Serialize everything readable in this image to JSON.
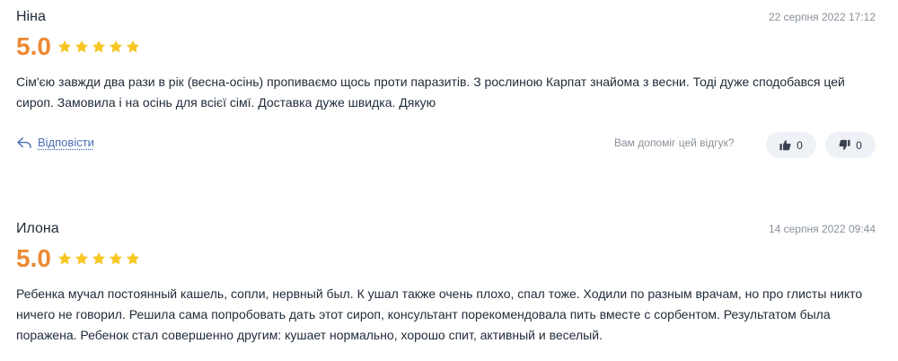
{
  "reviews": [
    {
      "author": "Ніна",
      "date": "22 серпня 2022 17:12",
      "score": "5.0",
      "stars": 5,
      "text": "Сім'єю завжди два рази в рік (весна-осінь) пропиваємо щось проти паразитів. З рослиною Карпат знайома з весни. Тоді дуже сподобався цей сироп. Замовила і на осінь для всієї сімї. Доставка дуже швидка. Дякую",
      "reply_label": "Відповісти",
      "helpful_prompt": "Вам допоміг цей відгук?",
      "likes": "0",
      "dislikes": "0"
    },
    {
      "author": "Илона",
      "date": "14 серпня 2022 09:44",
      "score": "5.0",
      "stars": 5,
      "text": "Ребенка мучал постоянный кашель, сопли, нервный был. К ушал также очень плохо, спал тоже. Ходили по разным врачам, но про глисты никто ничего не говорил. Решила сама попробовать дать этот сироп, консультант порекомендовала пить вместе с сорбентом. Результатом была поражена. Ребенок стал совершенно другим: кушает нормально, хорошо спит, активный и веселый."
    }
  ],
  "colors": {
    "score": "#ec8a34",
    "star": "#f7c623",
    "link": "#4a6fb3",
    "vote_bg": "#eef1f5"
  },
  "icons": {
    "star": "star-icon",
    "reply": "reply-arrow-icon",
    "like": "thumbs-up-icon",
    "dislike": "thumbs-down-icon"
  }
}
